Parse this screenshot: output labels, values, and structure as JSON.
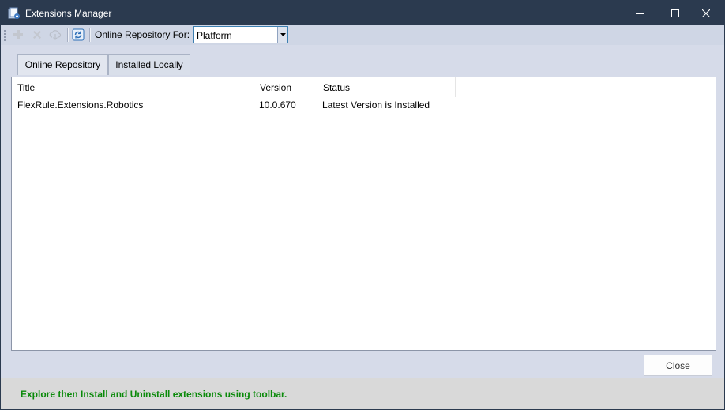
{
  "window": {
    "title": "Extensions Manager"
  },
  "toolbar": {
    "repo_label": "Online Repository For:",
    "repo_selected": "Platform",
    "icons": [
      "add-icon",
      "remove-icon",
      "cloud-download-icon",
      "refresh-icon"
    ]
  },
  "tabs": [
    {
      "label": "Online Repository"
    },
    {
      "label": "Installed Locally"
    }
  ],
  "table": {
    "columns": [
      "Title",
      "Version",
      "Status"
    ],
    "rows": [
      {
        "title": "FlexRule.Extensions.Robotics",
        "version": "10.0.670",
        "status": "Latest Version is Installed"
      }
    ]
  },
  "buttons": {
    "close_label": "Close"
  },
  "footer": {
    "hint": "Explore then Install and Uninstall extensions using toolbar."
  },
  "colors": {
    "titlebar": "#2b3a4f",
    "hint_green": "#0a8a0a",
    "refresh_blue": "#2d6fb7"
  }
}
